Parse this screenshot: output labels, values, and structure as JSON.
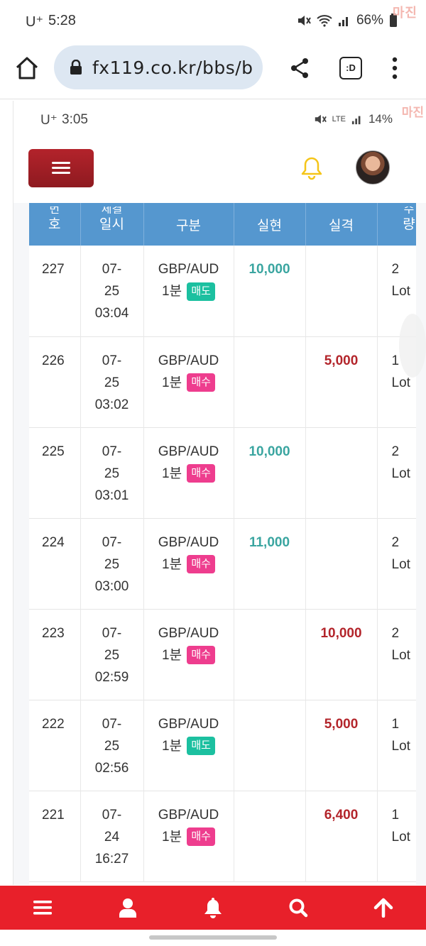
{
  "phone_status": {
    "carrier": "U⁺",
    "time": "5:28",
    "battery": "66%",
    "watermark": "마진"
  },
  "browser": {
    "url": "fx119.co.kr/bbs/b",
    "tabs_label": ":D"
  },
  "inner_status": {
    "carrier": "U⁺",
    "time": "3:05",
    "network": "LTE",
    "battery": "14%",
    "watermark": "마진"
  },
  "table": {
    "headers": [
      {
        "top": "번",
        "label": "호"
      },
      {
        "top": "체결",
        "label": "일시"
      },
      {
        "top": "",
        "label": "구분"
      },
      {
        "top": "",
        "label": "실현"
      },
      {
        "top": "",
        "label": "실격"
      },
      {
        "top": "수",
        "label": "량"
      }
    ],
    "rows": [
      {
        "no": "227",
        "date": "07-",
        "day": "25",
        "time": "03:04",
        "pair": "GBP/AUD",
        "period": "1분",
        "side": "매도",
        "side_type": "sell",
        "profit": "10,000",
        "loss": "",
        "qty": "2",
        "unit": "Lot"
      },
      {
        "no": "226",
        "date": "07-",
        "day": "25",
        "time": "03:02",
        "pair": "GBP/AUD",
        "period": "1분",
        "side": "매수",
        "side_type": "buy",
        "profit": "",
        "loss": "5,000",
        "qty": "1",
        "unit": "Lot"
      },
      {
        "no": "225",
        "date": "07-",
        "day": "25",
        "time": "03:01",
        "pair": "GBP/AUD",
        "period": "1분",
        "side": "매수",
        "side_type": "buy",
        "profit": "10,000",
        "loss": "",
        "qty": "2",
        "unit": "Lot"
      },
      {
        "no": "224",
        "date": "07-",
        "day": "25",
        "time": "03:00",
        "pair": "GBP/AUD",
        "period": "1분",
        "side": "매수",
        "side_type": "buy",
        "profit": "11,000",
        "loss": "",
        "qty": "2",
        "unit": "Lot"
      },
      {
        "no": "223",
        "date": "07-",
        "day": "25",
        "time": "02:59",
        "pair": "GBP/AUD",
        "period": "1분",
        "side": "매수",
        "side_type": "buy",
        "profit": "",
        "loss": "10,000",
        "qty": "2",
        "unit": "Lot"
      },
      {
        "no": "222",
        "date": "07-",
        "day": "25",
        "time": "02:56",
        "pair": "GBP/AUD",
        "period": "1분",
        "side": "매도",
        "side_type": "sell",
        "profit": "",
        "loss": "5,000",
        "qty": "1",
        "unit": "Lot"
      },
      {
        "no": "221",
        "date": "07-",
        "day": "24",
        "time": "16:27",
        "pair": "GBP/AUD",
        "period": "1분",
        "side": "매수",
        "side_type": "buy",
        "profit": "",
        "loss": "6,400",
        "qty": "1",
        "unit": "Lot"
      }
    ]
  },
  "colors": {
    "header_blue": "#5597cf",
    "profit": "#3aa5a0",
    "loss": "#b3252b",
    "sell_badge": "#1cc0a0",
    "buy_badge": "#ee3d8e",
    "bottom_nav": "#e8202a",
    "menu_button": "#a31f26",
    "bell": "#f5c518"
  },
  "bottom_nav": [
    "menu-icon",
    "user-icon",
    "bell-icon",
    "search-icon",
    "arrow-up-icon"
  ]
}
